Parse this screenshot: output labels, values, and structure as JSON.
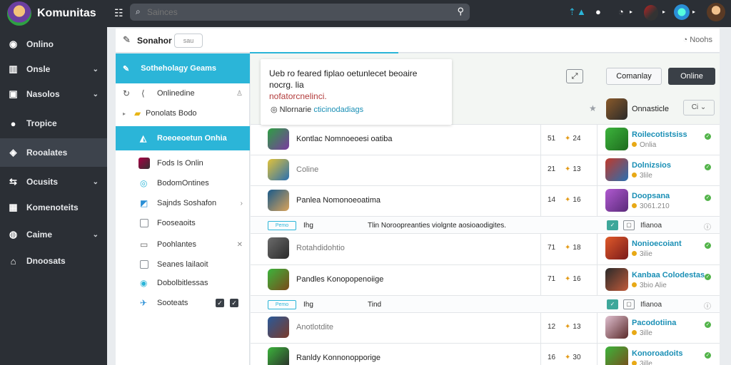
{
  "app": {
    "name": "Komunitas"
  },
  "sidebar": {
    "items": [
      {
        "label": "Onlino",
        "icon": "circle-icon",
        "chev": false,
        "active": false
      },
      {
        "label": "Onsle",
        "icon": "columns-icon",
        "chev": true,
        "active": false
      },
      {
        "label": "Nasolos",
        "icon": "briefcase-icon",
        "chev": true,
        "active": false
      },
      {
        "label": "Tropice",
        "icon": "dot-icon",
        "chev": false,
        "active": false
      },
      {
        "label": "Rooalates",
        "icon": "compass-icon",
        "chev": false,
        "active": true
      },
      {
        "label": "Ocusits",
        "icon": "arrows-icon",
        "chev": true,
        "active": false
      },
      {
        "label": "Komenoteits",
        "icon": "calendar-icon",
        "chev": false,
        "active": false
      },
      {
        "label": "Caime",
        "icon": "pin-icon",
        "chev": true,
        "active": false
      },
      {
        "label": "Dnoosats",
        "icon": "home-icon",
        "chev": false,
        "active": false
      }
    ]
  },
  "search": {
    "placeholder": "Sainces"
  },
  "header": {
    "title": "Sonahor",
    "pill": "sau",
    "notes": "Noohs"
  },
  "tree": {
    "header": "Sotheholagy Geams",
    "rows": [
      {
        "label": "Onlinedine"
      },
      {
        "label": "Ponolats Bodo"
      },
      {
        "label": "Roeoeoetun Onhia"
      },
      {
        "label": "Fods Is Onlin"
      },
      {
        "label": "BodomOntines"
      },
      {
        "label": "Sajnds Soshafon"
      },
      {
        "label": "Fooseaoits"
      },
      {
        "label": "Poohlantes"
      },
      {
        "label": "Seanes lailaoit"
      },
      {
        "label": "Dobolbitlessas"
      },
      {
        "label": "Sooteats"
      }
    ]
  },
  "notice": {
    "line1": "Ueb ro feared fiplao oetunlecet beoaire nocrg. lia",
    "line2": "nofatorcnelinci.",
    "link_prefix": "Nlornarie",
    "link_text": "cticinodadiags"
  },
  "actions": {
    "community": "Comanlay",
    "online": "Online"
  },
  "owner": {
    "label": "Onnasticle",
    "dropdown": "Ci"
  },
  "rows": [
    {
      "name": "Kontlac Nomnoeoesi oatiba",
      "n1": "51",
      "n2": "24",
      "right_title": "Roilecotistsiss",
      "right_sub": "Onlia"
    },
    {
      "name": "Coline",
      "n1": "21",
      "n2": "13",
      "right_title": "Dolnizsios",
      "right_sub": "3lile"
    },
    {
      "name": "Panlea Nomonoeoatima",
      "n1": "14",
      "n2": "16",
      "right_title": "Doopsana",
      "right_sub": "3061.210"
    },
    {
      "name": "Rotahdidohtio",
      "n1": "71",
      "n2": "18",
      "right_title": "Nonioecoiant",
      "right_sub": "3ilie"
    },
    {
      "name": "Pandles Konopopenoiige",
      "n1": "71",
      "n2": "16",
      "right_title": "Kanbaa Colodestas",
      "right_sub": "3bio Alie"
    },
    {
      "name": "Anotlotdite",
      "n1": "12",
      "n2": "13",
      "right_title": "Pacodotiina",
      "right_sub": "3ille"
    },
    {
      "name": "Ranldy Konnonopporige",
      "n1": "16",
      "n2": "30",
      "right_title": "Konoroadoits",
      "right_sub": "3ille"
    }
  ],
  "bands": [
    {
      "tag": "Pemo",
      "a": "Ihg",
      "b": "Tlin Noroopreanties violgnte aosioaodigites.",
      "c": "Ifianoa"
    },
    {
      "tag": "Pemo",
      "a": "Ihg",
      "b": "Tind",
      "c": "Ifianoa"
    }
  ]
}
